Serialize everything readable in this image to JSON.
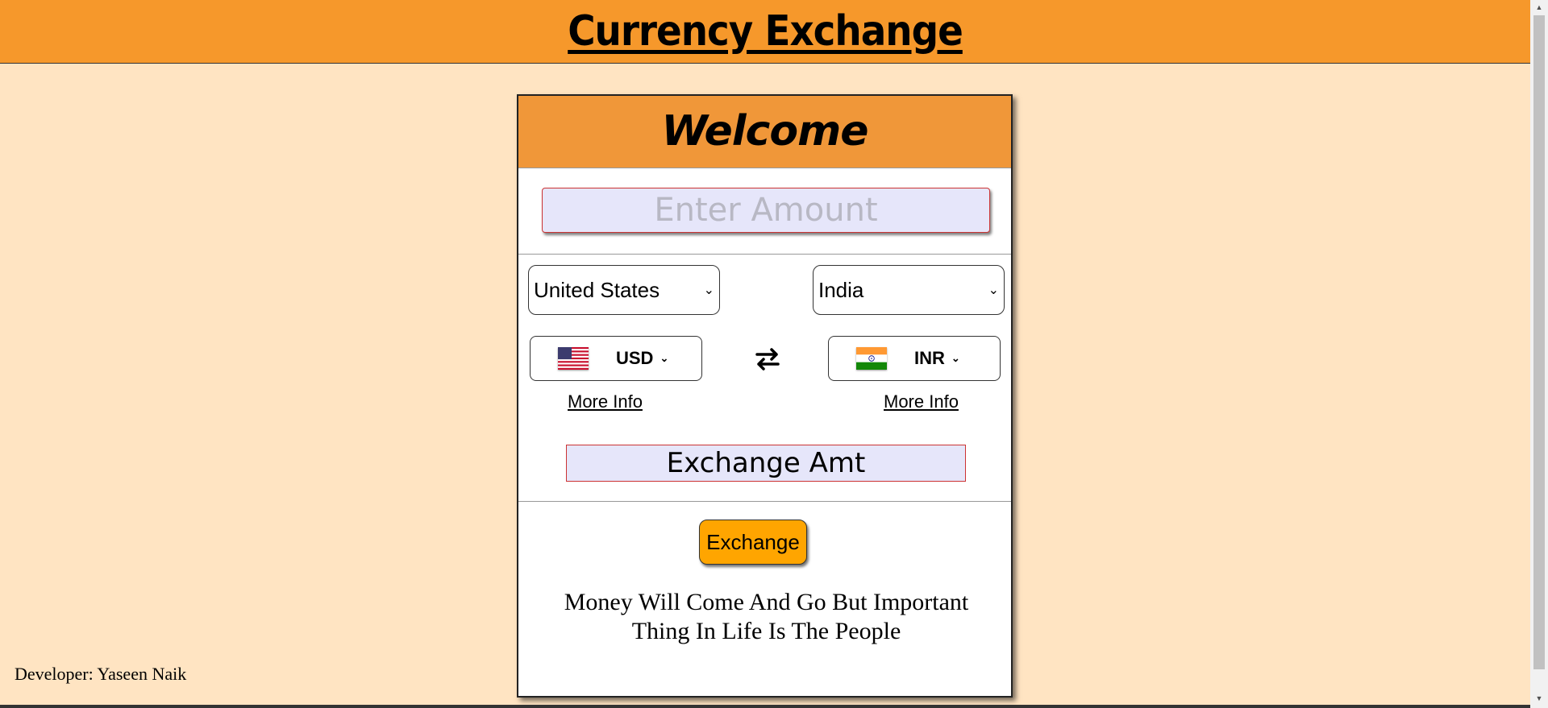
{
  "header": {
    "title": "Currency Exchange"
  },
  "card": {
    "welcome": "Welcome",
    "amount_placeholder": "Enter Amount",
    "from_country": "United States",
    "to_country": "India",
    "from_currency": "USD",
    "to_currency": "INR",
    "more_info_label": "More Info",
    "result_text": "Exchange Amt",
    "exchange_button": "Exchange",
    "quote": "Money Will Come And Go But Important Thing In Life Is The People"
  },
  "footer": {
    "developer": "Developer: Yaseen Naik"
  },
  "colors": {
    "page_bg": "#ffe4c2",
    "header_bg": "#f6982b",
    "card_header_bg": "#f09739",
    "button_bg": "#ffa500",
    "input_bg": "#e6e6fa"
  },
  "icons": {
    "swap": "swap-arrows-icon",
    "from_flag": "us-flag-icon",
    "to_flag": "india-flag-icon"
  }
}
